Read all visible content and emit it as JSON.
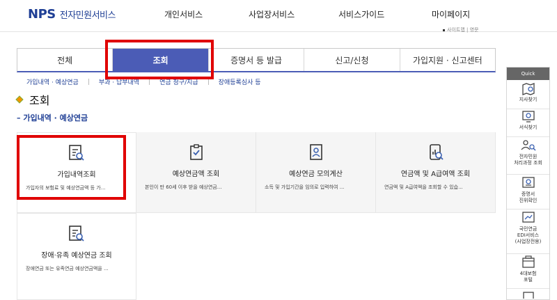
{
  "header": {
    "logo_mark": "NPS",
    "logo_text": "전자민원서비스",
    "nav": [
      "개인서비스",
      "사업장서비스",
      "서비스가이드",
      "마이페이지"
    ],
    "util_text": "사이트맵 | 영문"
  },
  "tabs": [
    "전체",
    "조회",
    "증명서 등 발급",
    "신고/신청",
    "가입지원 · 신고센터"
  ],
  "active_tab": "조회",
  "sub_tabs": [
    "가입내역 · 예상연금",
    "부과 · 납부내역",
    "연금 청구/지급",
    "장애등록심사 등"
  ],
  "page_title": "조회",
  "section_title": "가입내역 · 예상연금",
  "cards": [
    {
      "title": "가입내역조회",
      "desc": "가입자의 보험료 및 예상연금액 등 가...",
      "icon": "document-search-icon"
    },
    {
      "title": "예상연금액 조회",
      "desc": "본인이 만 60세 이후 받을 예상연금...",
      "icon": "clipboard-check-icon"
    },
    {
      "title": "예상연금 모의계산",
      "desc": "소득 및 가입기간을 임의로 입력하여 ...",
      "icon": "person-document-icon"
    },
    {
      "title": "연금액 및 A급여액 조회",
      "desc": "연금액 및 A급여액을 조회할 수 있습...",
      "icon": "mobile-chart-icon"
    },
    {
      "title": "장애·유족 예상연금 조회",
      "desc": "장애연금 또는 유족연금 예상연금액을 ...",
      "icon": "document-search-icon"
    }
  ],
  "quick": {
    "header": "Quick",
    "items": [
      {
        "label": "지사찾기",
        "icon": "map-pin-icon"
      },
      {
        "label": "서식찾기",
        "icon": "monitor-search-icon"
      },
      {
        "label": "전자민원\n처리과정 조회",
        "icon": "people-search-icon"
      },
      {
        "label": "증명서\n진위확인",
        "icon": "certificate-icon"
      },
      {
        "label": "국민연금\nEDI서비스\n(사업장전용)",
        "icon": "edi-icon"
      },
      {
        "label": "4대보험\n포털",
        "icon": "portal-icon"
      }
    ]
  },
  "colors": {
    "primary": "#4b5cb6",
    "brand_blue": "#1f3f95",
    "highlight": "#e00000",
    "accent_orange": "#f29400",
    "accent_green": "#7cb342"
  }
}
